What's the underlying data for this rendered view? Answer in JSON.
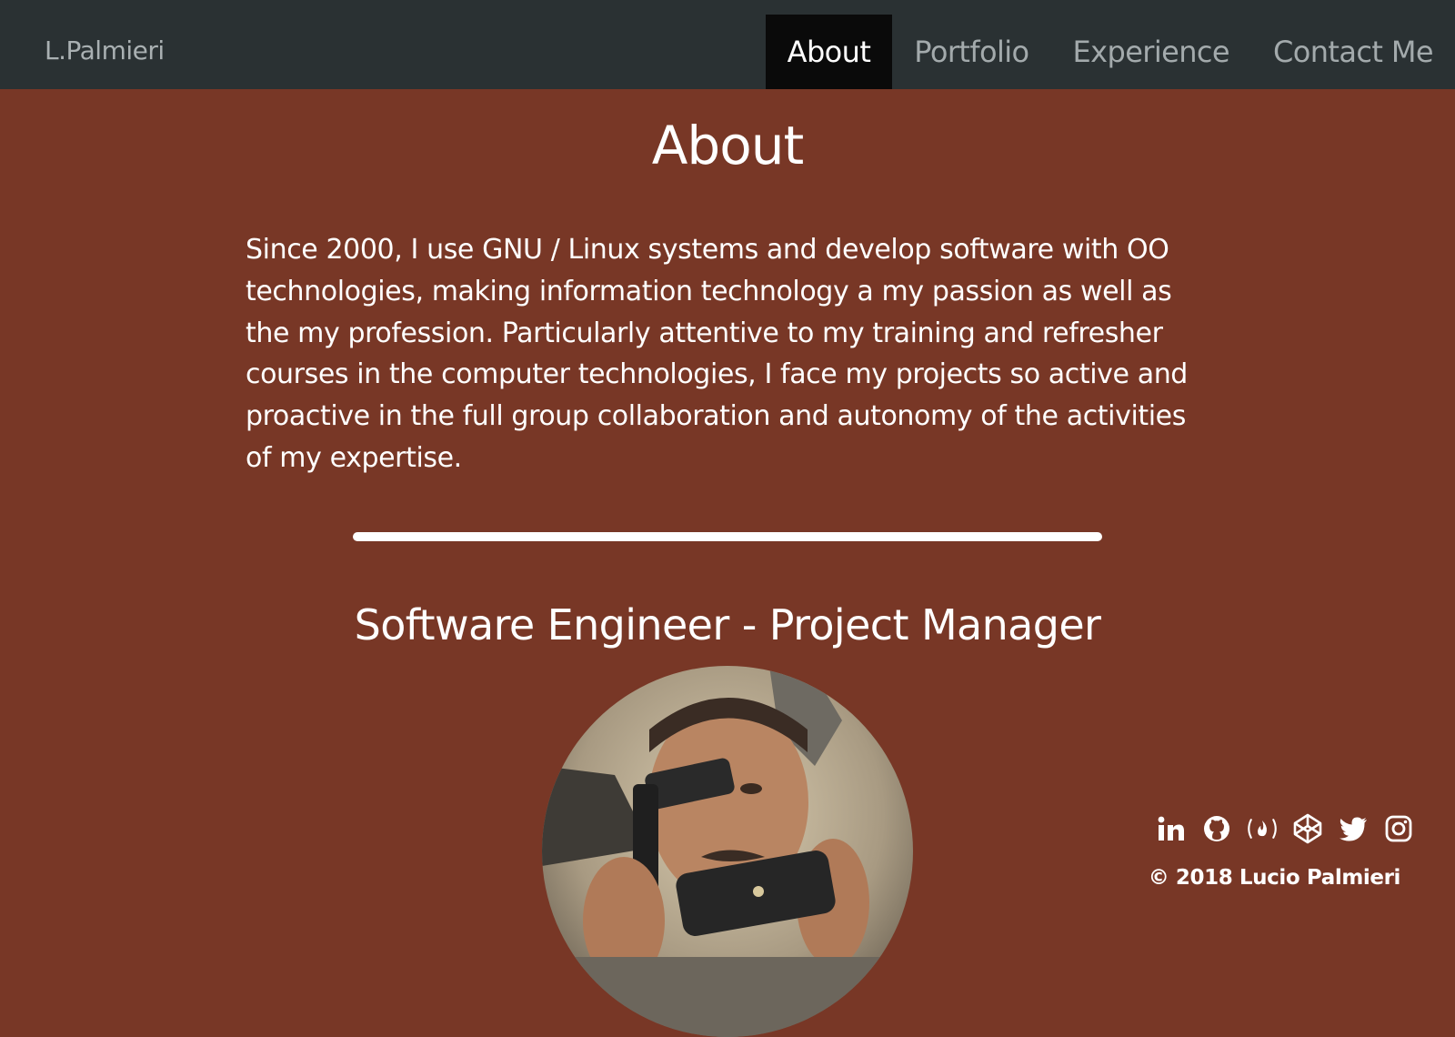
{
  "navbar": {
    "brand": "L.Palmieri",
    "items": [
      {
        "label": "About",
        "active": true
      },
      {
        "label": "Portfolio",
        "active": false
      },
      {
        "label": "Experience",
        "active": false
      },
      {
        "label": "Contact Me",
        "active": false
      }
    ]
  },
  "about": {
    "title": "About",
    "text": "Since 2000, I use GNU / Linux systems and develop software with OO technologies, making information technology a my passion as well as the my profession. Particularly attentive to my training and refresher courses in the computer technologies, I face my projects so active and proactive in the full group collaboration and autonomy of the activities of my expertise."
  },
  "profile": {
    "role": "Software Engineer - Project Manager",
    "photo": "profile-photo"
  },
  "footer": {
    "social_icons": [
      "linkedin-icon",
      "github-icon",
      "freecodecamp-icon",
      "codepen-icon",
      "twitter-icon",
      "instagram-icon"
    ],
    "copyright": "© 2018 Lucio Palmieri"
  },
  "colors": {
    "navbar_bg": "#2a3133",
    "page_bg": "#783726",
    "active_nav_bg": "#0a0a0a",
    "nav_text": "#a3aaac",
    "text": "#ffffff"
  }
}
